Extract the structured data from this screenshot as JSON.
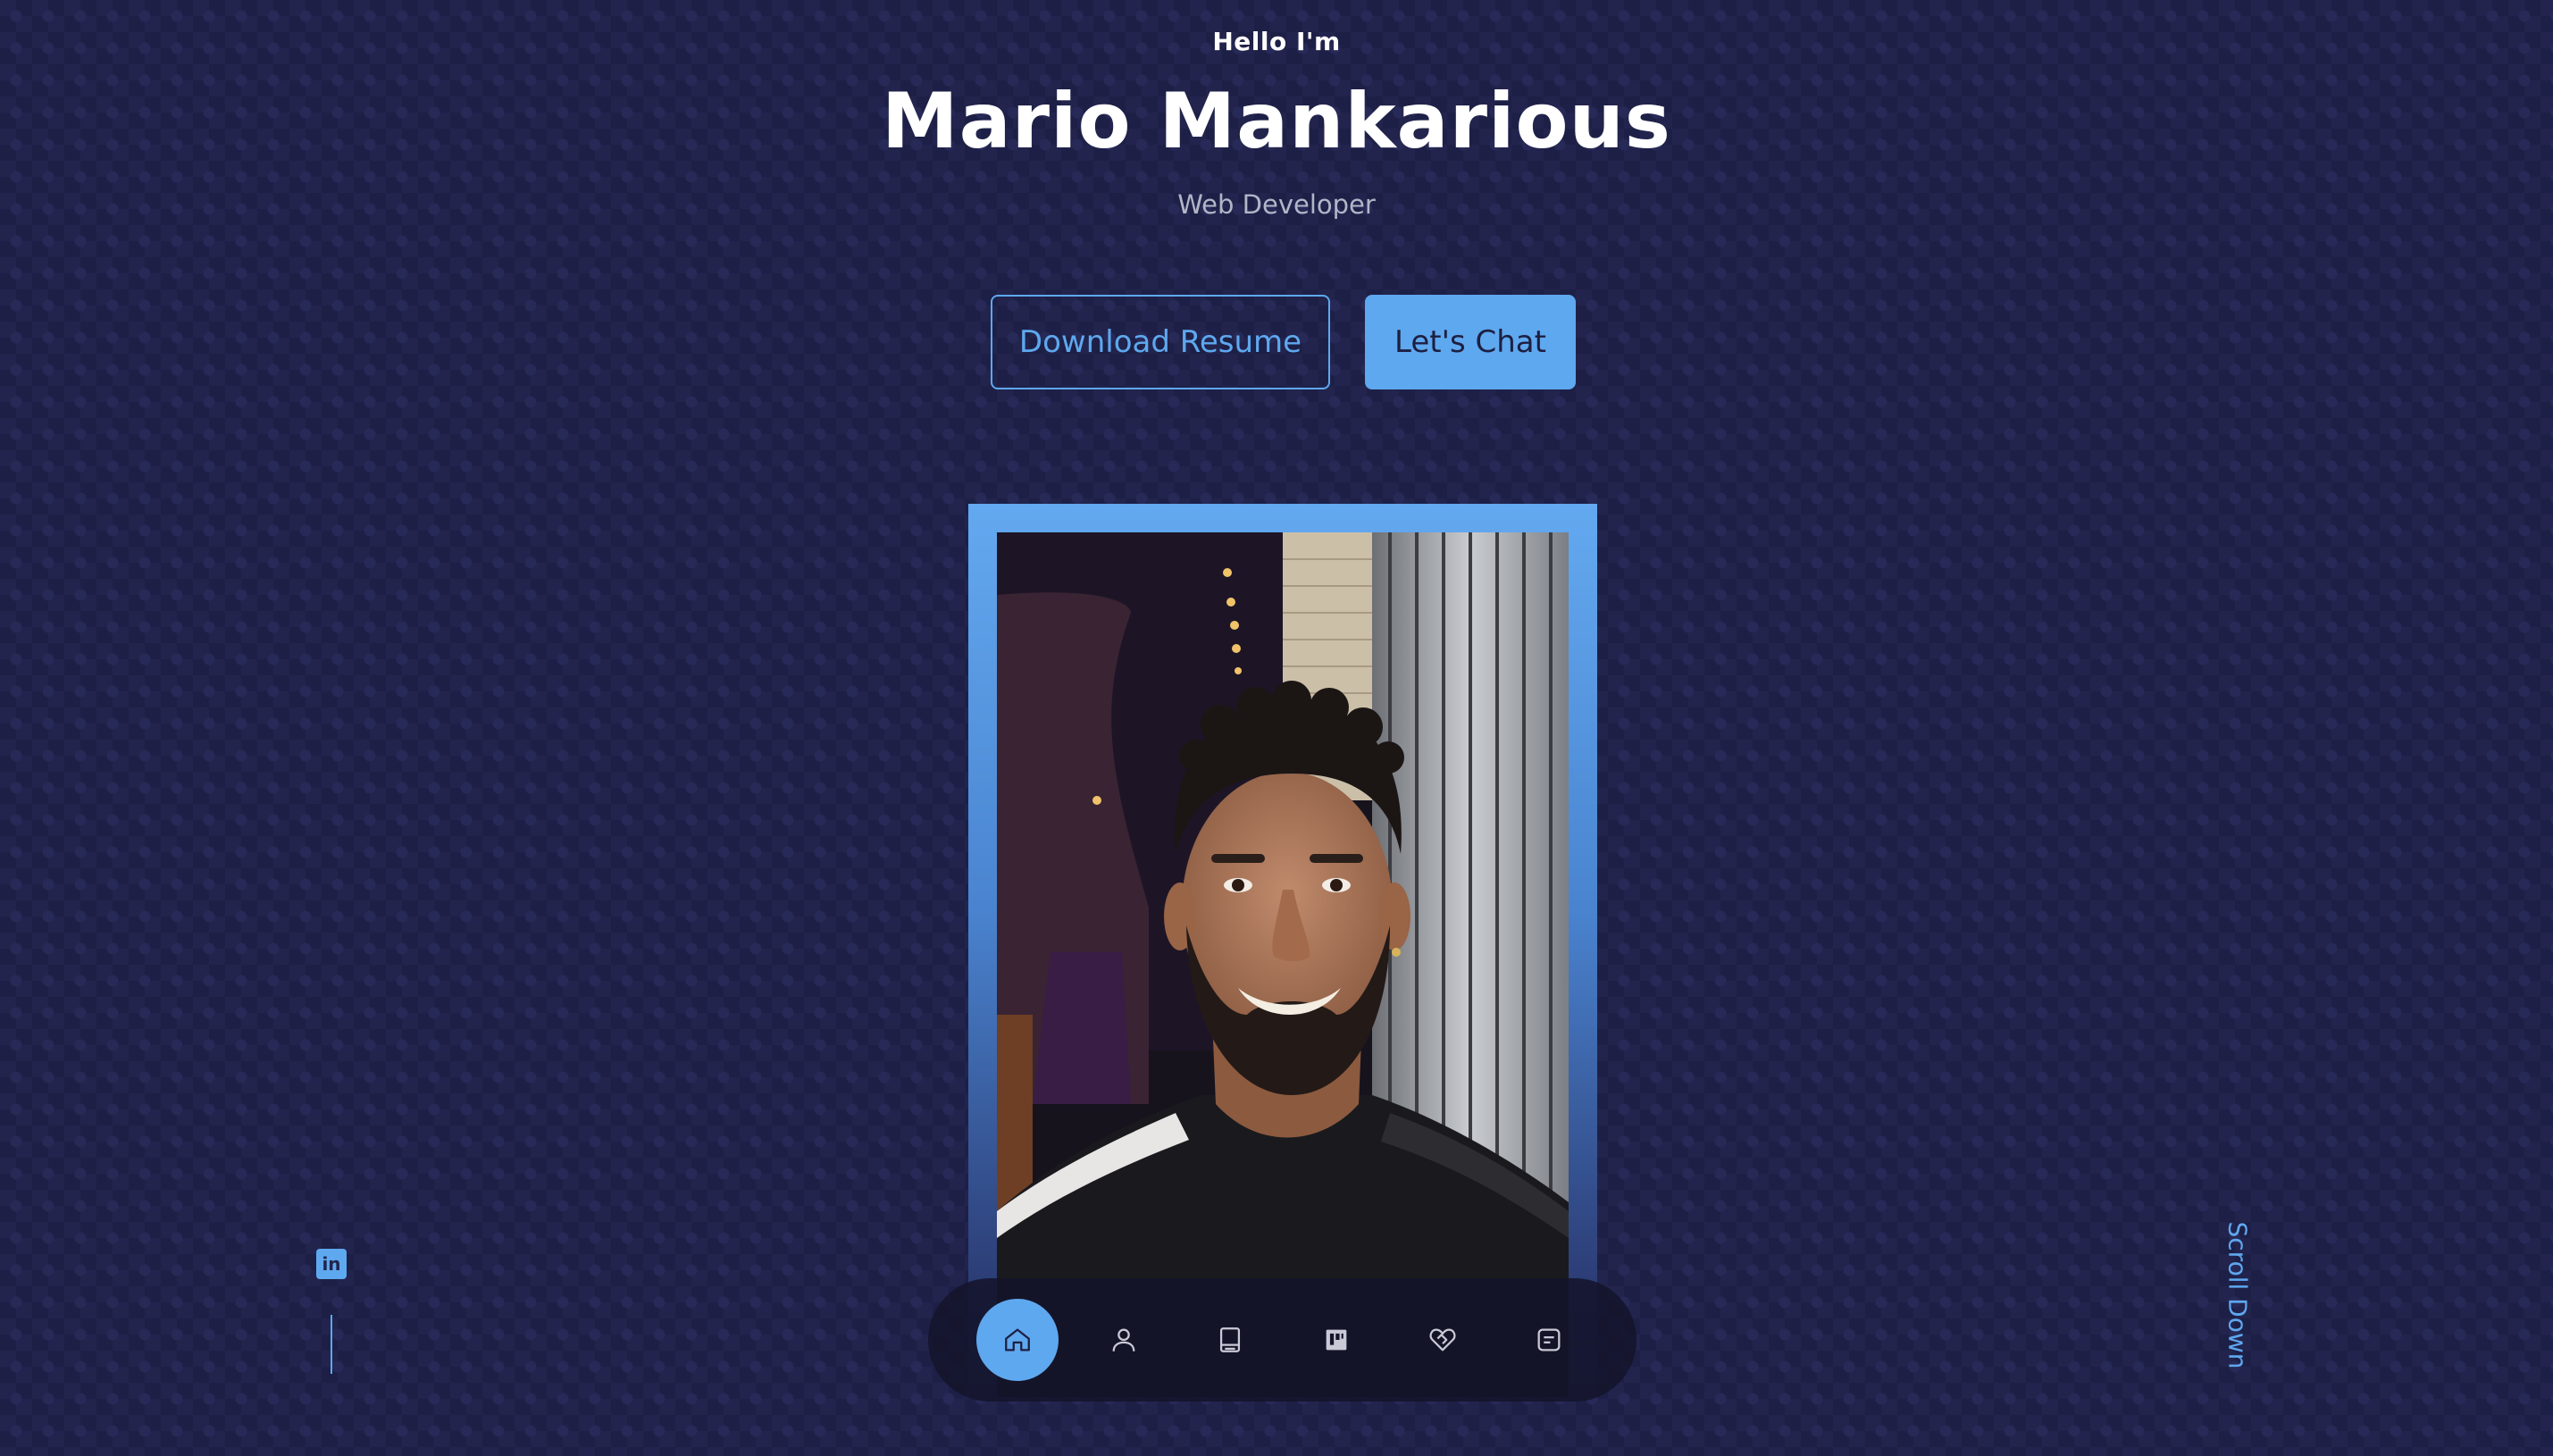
{
  "hero": {
    "greeting": "Hello I'm",
    "name": "Mario Mankarious",
    "role": "Web Developer"
  },
  "actions": {
    "download_resume": "Download Resume",
    "lets_chat": "Let's Chat"
  },
  "nav": {
    "items": [
      {
        "icon": "home-icon",
        "active": true
      },
      {
        "icon": "user-icon",
        "active": false
      },
      {
        "icon": "book-icon",
        "active": false
      },
      {
        "icon": "board-icon",
        "active": false
      },
      {
        "icon": "heart-handshake-icon",
        "active": false
      },
      {
        "icon": "message-icon",
        "active": false
      }
    ]
  },
  "social": {
    "linkedin_glyph": "in"
  },
  "scroll_hint": "Scroll Down",
  "colors": {
    "background": "#22244d",
    "accent": "#5ea8ef",
    "text": "#ffffff",
    "muted": "#b3b5c8"
  }
}
